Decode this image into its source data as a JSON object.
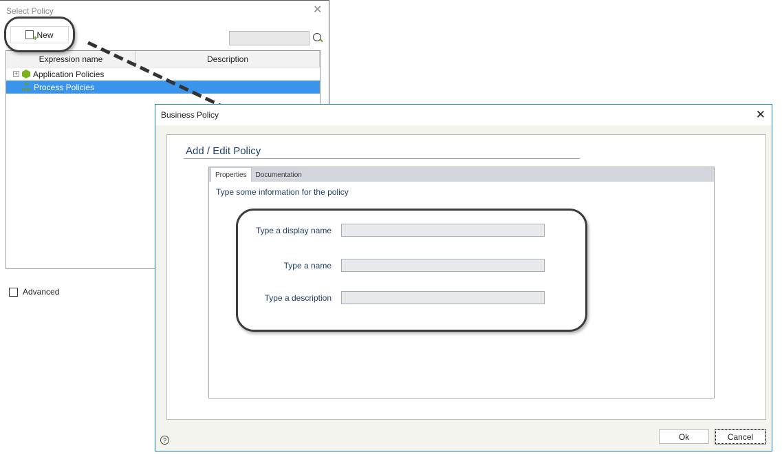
{
  "select_policy": {
    "title": "Select Policy",
    "new_button": "New",
    "search_placeholder": "",
    "columns": [
      "Expression name",
      "Description"
    ],
    "rows": [
      {
        "label": "Application Policies",
        "icon": "hexagon-icon",
        "expandable": true,
        "selected": false
      },
      {
        "label": "Process Policies",
        "icon": "process-icon",
        "expandable": false,
        "selected": true
      }
    ],
    "advanced_label": "Advanced",
    "advanced_checked": false
  },
  "business_policy": {
    "title": "Business Policy",
    "heading": "Add / Edit Policy",
    "tabs": [
      {
        "label": "Properties",
        "active": true
      },
      {
        "label": "Documentation",
        "active": false
      }
    ],
    "description": "Type some information for the policy",
    "fields": [
      {
        "label": "Type a display name",
        "value": ""
      },
      {
        "label": "Type a name",
        "value": ""
      },
      {
        "label": "Type a description",
        "value": ""
      }
    ],
    "ok_button": "Ok",
    "cancel_button": "Cancel",
    "help_icon": "?"
  }
}
